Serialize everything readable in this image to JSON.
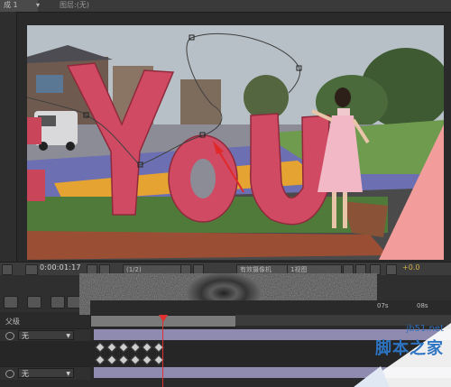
{
  "tabs": {
    "comp_tab": "成 1",
    "comp_menu": "▾",
    "layer_tab": "图层:(无)"
  },
  "viewer": {
    "photo_subject": "YOU"
  },
  "viewer_toolbar": {
    "timecode": "0:00:01:17",
    "zoom": "(1/2)",
    "view": "有效摄像机",
    "layout": "1视图",
    "exposure": "+0.0"
  },
  "timeline": {
    "ruler_labels": [
      "07s",
      "08s"
    ],
    "column_header": "父级",
    "layers": [
      {
        "mode": "无"
      },
      {
        "mode": "无"
      }
    ],
    "keyframes_per_row": 6
  },
  "watermark": {
    "url": "jb51.net",
    "name": "脚本之家"
  },
  "colors": {
    "track_bar": "#8f8bb0",
    "playhead": "#e03030",
    "exposure": "#d2b14a",
    "watermark": "#2d74c3"
  }
}
